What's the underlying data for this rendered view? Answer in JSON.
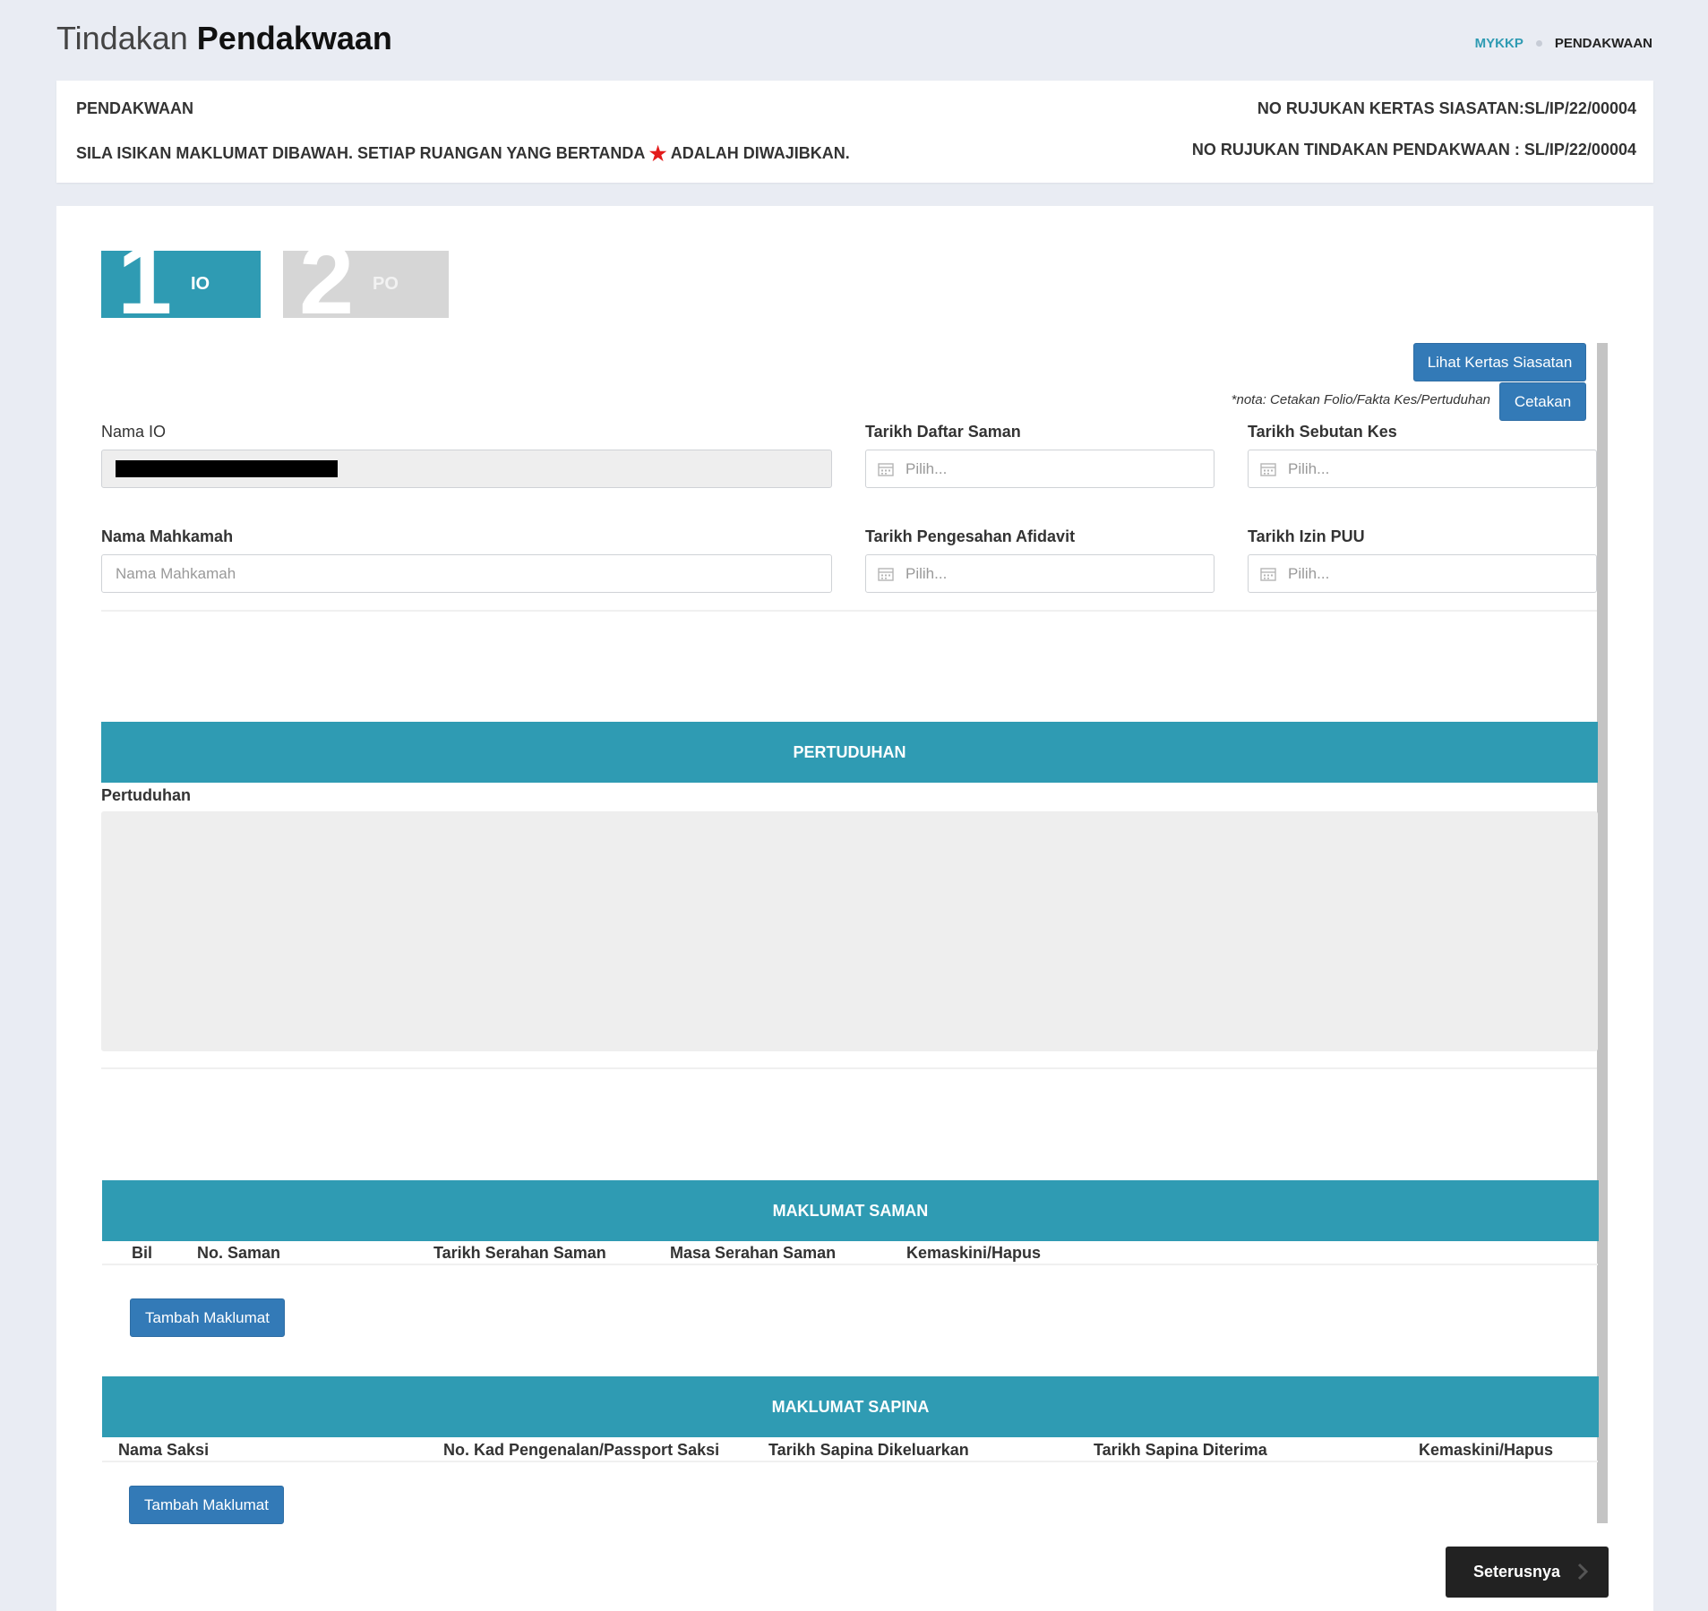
{
  "header": {
    "title_light": "Tindakan",
    "title_bold": "Pendakwaan",
    "breadcrumb": [
      "MYKKP",
      "PENDAKWAAN"
    ]
  },
  "info": {
    "heading": "PENDAKWAAN",
    "instruction_before": "SILA ISIKAN MAKLUMAT DIBAWAH. SETIAP RUANGAN YANG BERTANDA",
    "instruction_after": "ADALAH DIWAJIBKAN.",
    "ref_ks": "NO RUJUKAN KERTAS SIASATAN:SL/IP/22/00004",
    "ref_tp": "NO RUJUKAN TINDAKAN PENDAKWAAN : SL/IP/22/00004"
  },
  "steps": [
    {
      "num": "1",
      "label": "IO",
      "active": true
    },
    {
      "num": "2",
      "label": "PO",
      "active": false
    }
  ],
  "actions": {
    "view_ks": "Lihat Kertas Siasatan",
    "print_note": "*nota: Cetakan Folio/Fakta Kes/Pertuduhan",
    "print": "Cetakan"
  },
  "form": {
    "nama_io": {
      "label": "Nama IO"
    },
    "tarikh_daftar_saman": {
      "label": "Tarikh Daftar Saman",
      "placeholder": "Pilih..."
    },
    "tarikh_sebutan_kes": {
      "label": "Tarikh Sebutan Kes",
      "placeholder": "Pilih..."
    },
    "nama_mahkamah": {
      "label": "Nama Mahkamah",
      "placeholder": "Nama Mahkamah"
    },
    "tarikh_pengesahan_afidavit": {
      "label": "Tarikh Pengesahan Afidavit",
      "placeholder": "Pilih..."
    },
    "tarikh_izin_puu": {
      "label": "Tarikh Izin PUU",
      "placeholder": "Pilih..."
    }
  },
  "pertuduhan": {
    "header": "PERTUDUHAN",
    "label": "Pertuduhan"
  },
  "saman": {
    "header": "MAKLUMAT SAMAN",
    "columns": [
      "Bil",
      "No. Saman",
      "Tarikh Serahan Saman",
      "Masa Serahan Saman",
      "Kemaskini/Hapus"
    ],
    "add_button": "Tambah Maklumat"
  },
  "sapina": {
    "header": "MAKLUMAT SAPINA",
    "columns": [
      "Nama Saksi",
      "No. Kad Pengenalan/Passport Saksi",
      "Tarikh Sapina Dikeluarkan",
      "Tarikh Sapina Diterima",
      "Kemaskini/Hapus"
    ],
    "add_button": "Tambah Maklumat"
  },
  "footer": {
    "next_button": "Seterusnya"
  },
  "colors": {
    "accent": "#2f9bb3",
    "button_blue": "#337ab7",
    "required_star": "#e31b1b",
    "next_button": "#222222"
  }
}
